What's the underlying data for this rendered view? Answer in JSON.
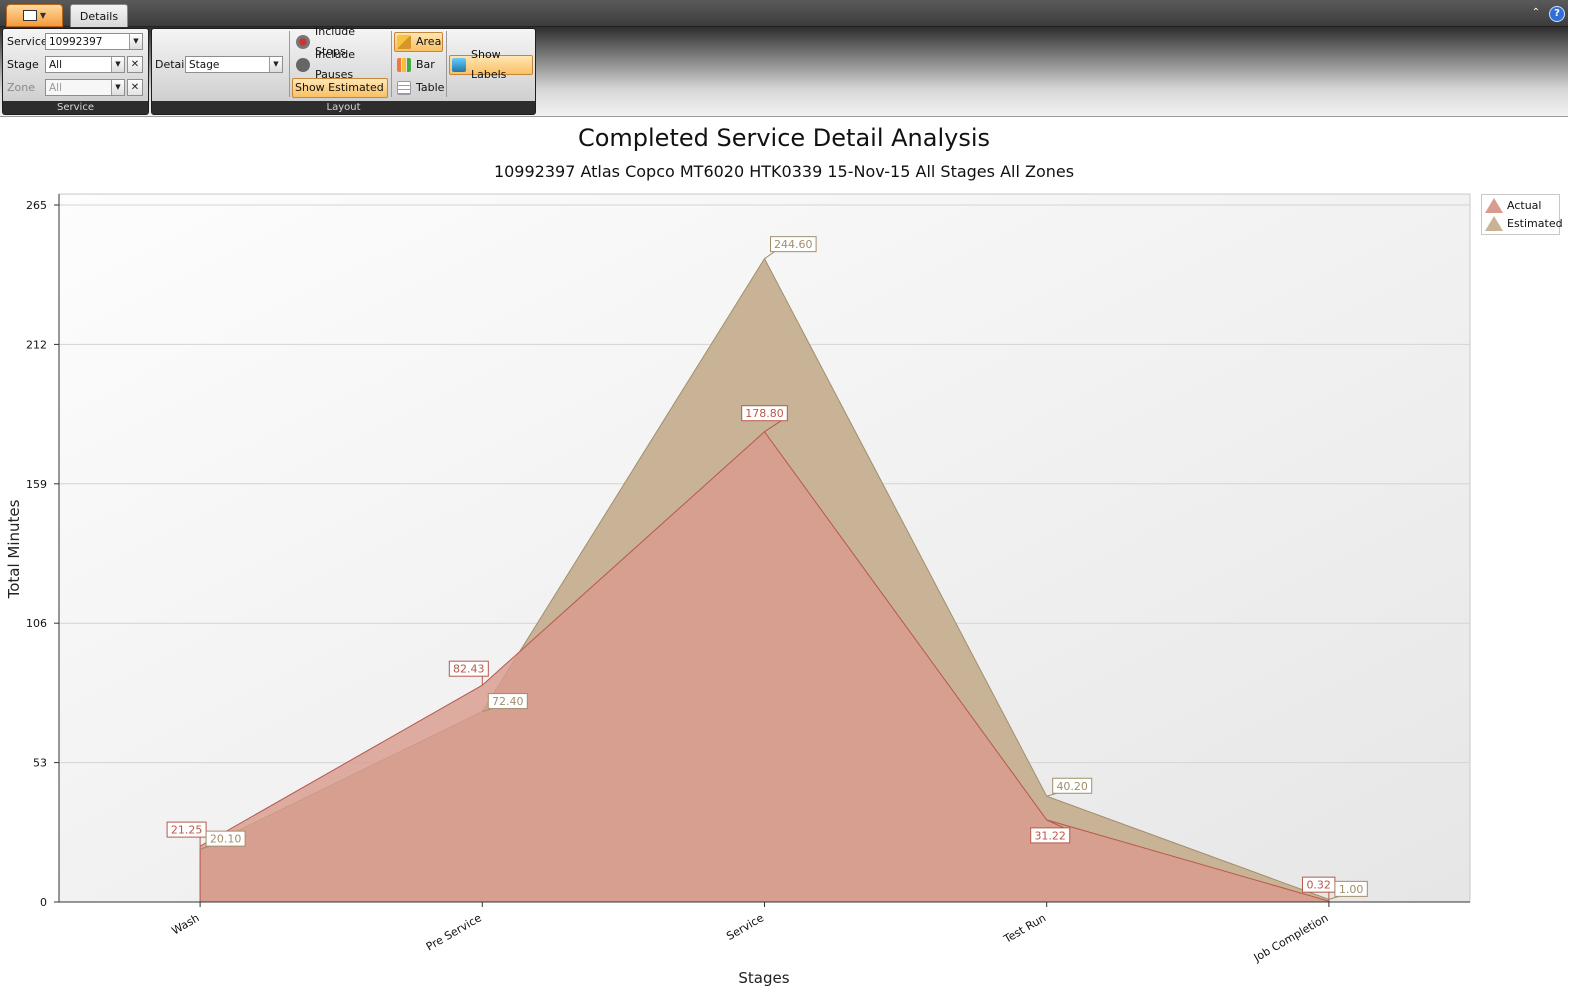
{
  "toolbar": {
    "tab_label": "Details",
    "service_group": {
      "caption": "Service",
      "service_label": "Service",
      "service_value": "10992397",
      "stage_label": "Stage",
      "stage_value": "All",
      "zone_label": "Zone",
      "zone_value": "All"
    },
    "layout_group": {
      "caption": "Layout",
      "detail_label": "Detail",
      "detail_value": "Stage",
      "include_stops": "Include Stops",
      "include_pauses": "Include Pauses",
      "show_estimated": "Show Estimated",
      "area": "Area",
      "bar": "Bar",
      "table": "Table",
      "show_labels": "Show Labels"
    },
    "colors": {
      "active_button": "#f9c165",
      "ribbon_dark": "#2d2d2d"
    }
  },
  "chart_data": {
    "type": "area",
    "title": "Completed Service Detail Analysis",
    "subtitle": "10992397 Atlas Copco MT6020 HTK0339 15-Nov-15 All Stages All Zones",
    "xlabel": "Stages",
    "ylabel": "Total Minutes",
    "categories": [
      "Wash",
      "Pre Service",
      "Service",
      "Test Run",
      "Job Completion"
    ],
    "ylim": [
      0,
      265
    ],
    "yticks": [
      "0",
      "53",
      "106",
      "159",
      "212",
      "265"
    ],
    "grid": true,
    "legend_position": "top-right",
    "series": [
      {
        "name": "Actual",
        "values": [
          21.25,
          82.43,
          178.8,
          31.22,
          0.32
        ],
        "labels": [
          "21.25",
          "82.43",
          "178.80",
          "31.22",
          "0.32"
        ],
        "color": "#d99b8e",
        "line": "#b8584a"
      },
      {
        "name": "Estimated",
        "values": [
          20.1,
          72.4,
          244.6,
          40.2,
          1.0
        ],
        "labels": [
          "20.10",
          "72.40",
          "244.60",
          "40.20",
          "1.00"
        ],
        "color": "#c9b396",
        "line": "#a08f6c"
      }
    ]
  }
}
